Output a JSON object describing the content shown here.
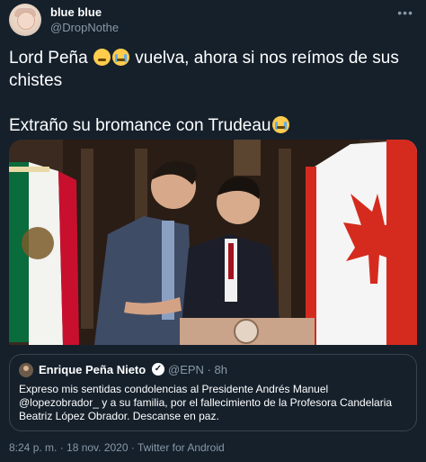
{
  "tweet": {
    "display_name": "blue blue",
    "handle": "@DropNothe",
    "more_label": "•••",
    "text_line1": "Lord Peña ",
    "text_line1_after": " vuelva, ahora si nos reímos de sus chistes",
    "text_line2": "Extraño su bromance con Trudeau",
    "emojis": [
      "persevering-face-emoji",
      "loudly-crying-face-emoji"
    ]
  },
  "quoted_tweet": {
    "display_name": "Enrique Peña Nieto",
    "verified_mark": "✓",
    "handle_and_time": "@EPN · 8h",
    "text": "Expreso mis sentidas condolencias al Presidente Andrés Manuel @lopezobrador_ y a su familia, por el fallecimiento de la Profesora Candelaria Beatriz López Obrador.  Descanse en paz."
  },
  "footer": {
    "timestamp": "8:24 p. m. · 18 nov. 2020 · Twitter for Android"
  },
  "colors": {
    "background": "#15202b",
    "secondary_text": "#8899a6",
    "border": "#38444d"
  }
}
